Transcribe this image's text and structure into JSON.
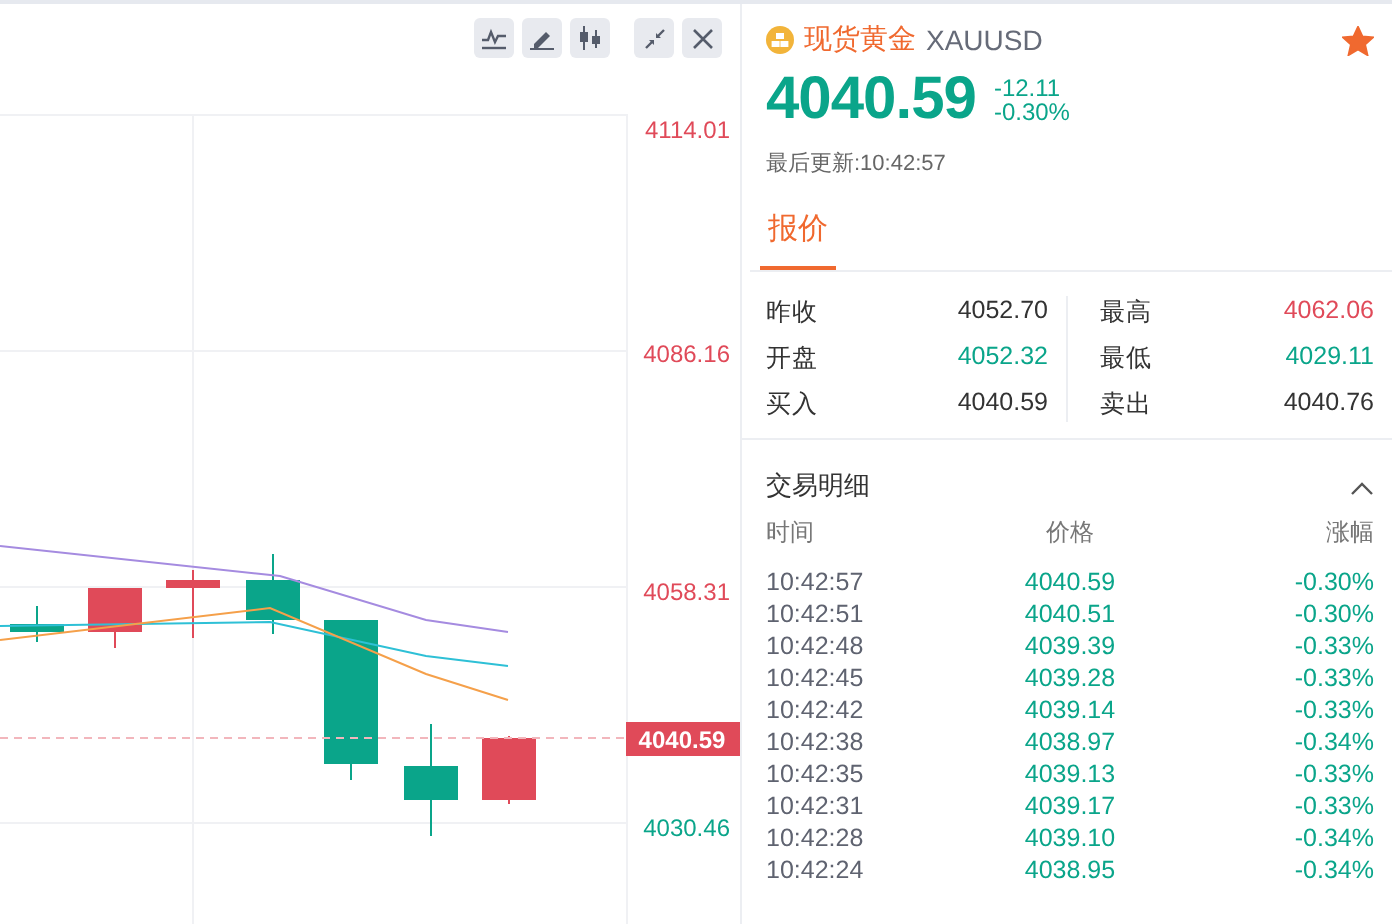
{
  "chart": {
    "toolbar": [
      {
        "kind": "indicator"
      },
      {
        "kind": "draw"
      },
      {
        "kind": "candles"
      },
      {
        "kind": "shrink"
      },
      {
        "kind": "close"
      }
    ],
    "price_axis": [
      {
        "label": "4114.01",
        "color": "#e04a59"
      },
      {
        "label": "4086.16",
        "color": "#e04a59"
      },
      {
        "label": "4058.31",
        "color": "#e04a59"
      },
      {
        "label": "4030.46",
        "color": "#0aa58a"
      }
    ],
    "last_price_tag": "4040.59"
  },
  "quote": {
    "name": "现货黄金",
    "symbol": "XAUUSD",
    "favorite": true,
    "price": "4040.59",
    "change": "-12.11",
    "change_pct": "-0.30%",
    "color": "#0aa58a",
    "updated": "最后更新:10:42:57",
    "tabs": [
      {
        "label": "报价",
        "selected": true
      }
    ],
    "stats": [
      {
        "label": "昨收",
        "value": "4052.70",
        "color": "#333333"
      },
      {
        "label": "最高",
        "value": "4062.06",
        "color": "#e04a59"
      },
      {
        "label": "开盘",
        "value": "4052.32",
        "color": "#0aa58a"
      },
      {
        "label": "最低",
        "value": "4029.11",
        "color": "#0aa58a"
      },
      {
        "label": "买入",
        "value": "4040.59",
        "color": "#333333"
      },
      {
        "label": "卖出",
        "value": "4040.76",
        "color": "#333333"
      }
    ]
  },
  "trades": {
    "title": "交易明细",
    "expanded": true,
    "columns": [
      "时间",
      "价格",
      "涨幅"
    ],
    "rows": [
      {
        "time": "10:42:57",
        "price": "4040.59",
        "change": "-0.30%",
        "color": "#0aa58a"
      },
      {
        "time": "10:42:51",
        "price": "4040.51",
        "change": "-0.30%",
        "color": "#0aa58a"
      },
      {
        "time": "10:42:48",
        "price": "4039.39",
        "change": "-0.33%",
        "color": "#0aa58a"
      },
      {
        "time": "10:42:45",
        "price": "4039.28",
        "change": "-0.33%",
        "color": "#0aa58a"
      },
      {
        "time": "10:42:42",
        "price": "4039.14",
        "change": "-0.33%",
        "color": "#0aa58a"
      },
      {
        "time": "10:42:38",
        "price": "4038.97",
        "change": "-0.34%",
        "color": "#0aa58a"
      },
      {
        "time": "10:42:35",
        "price": "4039.13",
        "change": "-0.33%",
        "color": "#0aa58a"
      },
      {
        "time": "10:42:31",
        "price": "4039.17",
        "change": "-0.33%",
        "color": "#0aa58a"
      },
      {
        "time": "10:42:28",
        "price": "4039.10",
        "change": "-0.34%",
        "color": "#0aa58a"
      },
      {
        "time": "10:42:24",
        "price": "4038.95",
        "change": "-0.34%",
        "color": "#0aa58a"
      }
    ]
  }
}
